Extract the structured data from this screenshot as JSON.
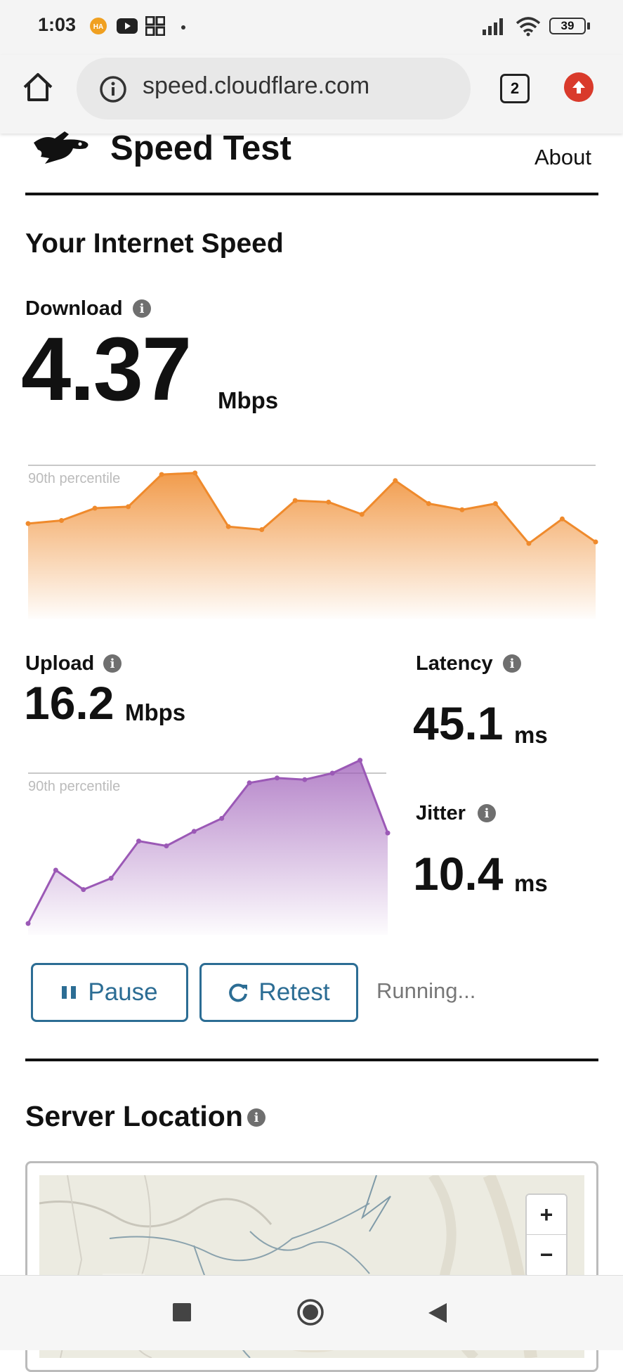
{
  "status_bar": {
    "time": "1:03",
    "app_badge": "HA",
    "battery": "39"
  },
  "browser": {
    "url": "speed.cloudflare.com",
    "tab_count": "2"
  },
  "header": {
    "title": "Speed Test",
    "about_link": "About"
  },
  "results": {
    "heading": "Your Internet Speed",
    "download": {
      "label": "Download",
      "value": "4.37",
      "unit": "Mbps",
      "percentile_label": "90th percentile"
    },
    "upload": {
      "label": "Upload",
      "value": "16.2",
      "unit": "Mbps",
      "percentile_label": "90th percentile"
    },
    "latency": {
      "label": "Latency",
      "value": "45.1",
      "unit": "ms"
    },
    "jitter": {
      "label": "Jitter",
      "value": "10.4",
      "unit": "ms"
    }
  },
  "controls": {
    "pause_label": "Pause",
    "retest_label": "Retest",
    "status": "Running..."
  },
  "server": {
    "heading": "Server Location",
    "zoom_in": "+",
    "zoom_out": "−"
  },
  "colors": {
    "download": "#ef8a2c",
    "upload": "#9b59b6",
    "button": "#2c6d94"
  },
  "chart_data": [
    {
      "type": "area",
      "name": "download-samples",
      "reference_line": "90th percentile",
      "x": [
        0,
        1,
        2,
        3,
        4,
        5,
        6,
        7,
        8,
        9,
        10,
        11,
        12,
        13,
        14,
        15,
        16,
        17
      ],
      "values": [
        0.62,
        0.64,
        0.72,
        0.73,
        0.94,
        0.95,
        0.6,
        0.58,
        0.77,
        0.76,
        0.68,
        0.9,
        0.75,
        0.71,
        0.75,
        0.49,
        0.65,
        0.5
      ],
      "value_scale": "fraction of chart height"
    },
    {
      "type": "area",
      "name": "upload-samples",
      "reference_line": "90th percentile",
      "x": [
        0,
        1,
        2,
        3,
        4,
        5,
        6,
        7,
        8,
        9,
        10,
        11,
        12,
        13
      ],
      "values": [
        0.07,
        0.4,
        0.28,
        0.35,
        0.58,
        0.55,
        0.64,
        0.72,
        0.94,
        0.97,
        0.96,
        1.0,
        1.08,
        0.63
      ],
      "value_scale": "fraction of chart height"
    }
  ]
}
